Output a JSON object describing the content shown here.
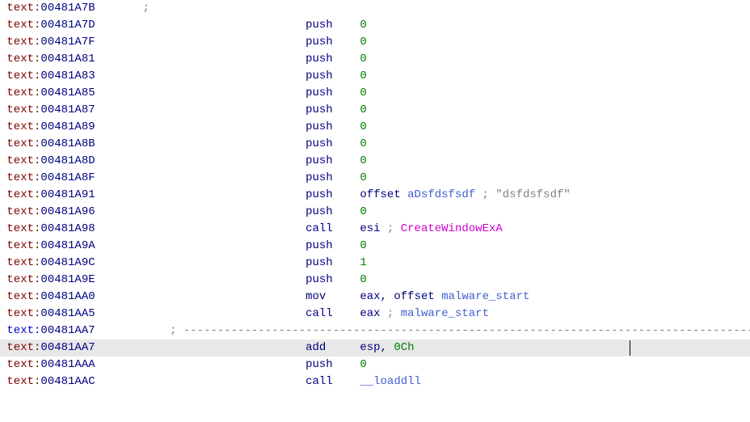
{
  "segment_label": "text",
  "dashed_segment_label": "text",
  "cursor_line_index": 21,
  "lines": [
    {
      "addr": "00481A7B",
      "items": [
        {
          "kind": "semicolon_only"
        }
      ]
    },
    {
      "addr": "00481A7D",
      "items": [
        {
          "kind": "instr",
          "mnemonic": "push",
          "operands": [
            {
              "t": "num",
              "v": "0"
            }
          ]
        }
      ]
    },
    {
      "addr": "00481A7F",
      "items": [
        {
          "kind": "instr",
          "mnemonic": "push",
          "operands": [
            {
              "t": "num",
              "v": "0"
            }
          ]
        }
      ]
    },
    {
      "addr": "00481A81",
      "items": [
        {
          "kind": "instr",
          "mnemonic": "push",
          "operands": [
            {
              "t": "num",
              "v": "0"
            }
          ]
        }
      ]
    },
    {
      "addr": "00481A83",
      "items": [
        {
          "kind": "instr",
          "mnemonic": "push",
          "operands": [
            {
              "t": "num",
              "v": "0"
            }
          ]
        }
      ]
    },
    {
      "addr": "00481A85",
      "items": [
        {
          "kind": "instr",
          "mnemonic": "push",
          "operands": [
            {
              "t": "num",
              "v": "0"
            }
          ]
        }
      ]
    },
    {
      "addr": "00481A87",
      "items": [
        {
          "kind": "instr",
          "mnemonic": "push",
          "operands": [
            {
              "t": "num",
              "v": "0"
            }
          ]
        }
      ]
    },
    {
      "addr": "00481A89",
      "items": [
        {
          "kind": "instr",
          "mnemonic": "push",
          "operands": [
            {
              "t": "num",
              "v": "0"
            }
          ]
        }
      ]
    },
    {
      "addr": "00481A8B",
      "items": [
        {
          "kind": "instr",
          "mnemonic": "push",
          "operands": [
            {
              "t": "num",
              "v": "0"
            }
          ]
        }
      ]
    },
    {
      "addr": "00481A8D",
      "items": [
        {
          "kind": "instr",
          "mnemonic": "push",
          "operands": [
            {
              "t": "num",
              "v": "0"
            }
          ]
        }
      ]
    },
    {
      "addr": "00481A8F",
      "items": [
        {
          "kind": "instr",
          "mnemonic": "push",
          "operands": [
            {
              "t": "num",
              "v": "0"
            }
          ]
        }
      ]
    },
    {
      "addr": "00481A91",
      "items": [
        {
          "kind": "instr",
          "mnemonic": "push",
          "operands": [
            {
              "t": "kw",
              "v": "offset"
            },
            {
              "t": "sp"
            },
            {
              "t": "ident",
              "v": "aDsfdsfsdf"
            }
          ],
          "comment": "\"dsfdsfsdf\""
        }
      ]
    },
    {
      "addr": "00481A96",
      "items": [
        {
          "kind": "instr",
          "mnemonic": "push",
          "operands": [
            {
              "t": "num",
              "v": "0"
            }
          ]
        }
      ]
    },
    {
      "addr": "00481A98",
      "items": [
        {
          "kind": "instr",
          "mnemonic": "call",
          "operands": [
            {
              "t": "reg",
              "v": "esi"
            }
          ],
          "post_semi": [
            {
              "t": "api",
              "v": "CreateWindowExA"
            }
          ]
        }
      ]
    },
    {
      "addr": "00481A9A",
      "items": [
        {
          "kind": "instr",
          "mnemonic": "push",
          "operands": [
            {
              "t": "num",
              "v": "0"
            }
          ]
        }
      ]
    },
    {
      "addr": "00481A9C",
      "items": [
        {
          "kind": "instr",
          "mnemonic": "push",
          "operands": [
            {
              "t": "num",
              "v": "1"
            }
          ]
        }
      ]
    },
    {
      "addr": "00481A9E",
      "items": [
        {
          "kind": "instr",
          "mnemonic": "push",
          "operands": [
            {
              "t": "num",
              "v": "0"
            }
          ]
        }
      ]
    },
    {
      "addr": "00481AA0",
      "items": [
        {
          "kind": "instr",
          "mnemonic": "mov",
          "operands": [
            {
              "t": "reg",
              "v": "eax"
            },
            {
              "t": "comma"
            },
            {
              "t": "sp"
            },
            {
              "t": "kw",
              "v": "offset"
            },
            {
              "t": "sp"
            },
            {
              "t": "ident",
              "v": "malware_start"
            }
          ]
        }
      ]
    },
    {
      "addr": "00481AA5",
      "items": [
        {
          "kind": "instr",
          "mnemonic": "call",
          "operands": [
            {
              "t": "reg",
              "v": "eax"
            }
          ],
          "post_semi": [
            {
              "t": "ident",
              "v": "malware_start"
            }
          ]
        }
      ]
    },
    {
      "addr": "00481AA7",
      "items": [
        {
          "kind": "dashes",
          "seg_style": "blue"
        }
      ]
    },
    {
      "addr": "00481AA7",
      "selected": true,
      "items": [
        {
          "kind": "instr",
          "mnemonic": "add",
          "operands": [
            {
              "t": "reg",
              "v": "esp"
            },
            {
              "t": "comma"
            },
            {
              "t": "sp"
            },
            {
              "t": "hex",
              "v": "0Ch"
            }
          ]
        }
      ]
    },
    {
      "addr": "00481AAA",
      "items": [
        {
          "kind": "instr",
          "mnemonic": "push",
          "operands": [
            {
              "t": "num",
              "v": "0"
            }
          ]
        }
      ]
    },
    {
      "addr": "00481AAC",
      "items": [
        {
          "kind": "instr",
          "mnemonic": "call",
          "operands": [
            {
              "t": "ident",
              "v": "__loaddll"
            }
          ]
        }
      ]
    }
  ],
  "columns": {
    "seg_start": 1,
    "mnemonic_col": 45,
    "operand_col": 53,
    "dashes_prefix_col": 25,
    "dashes_len": 88
  }
}
